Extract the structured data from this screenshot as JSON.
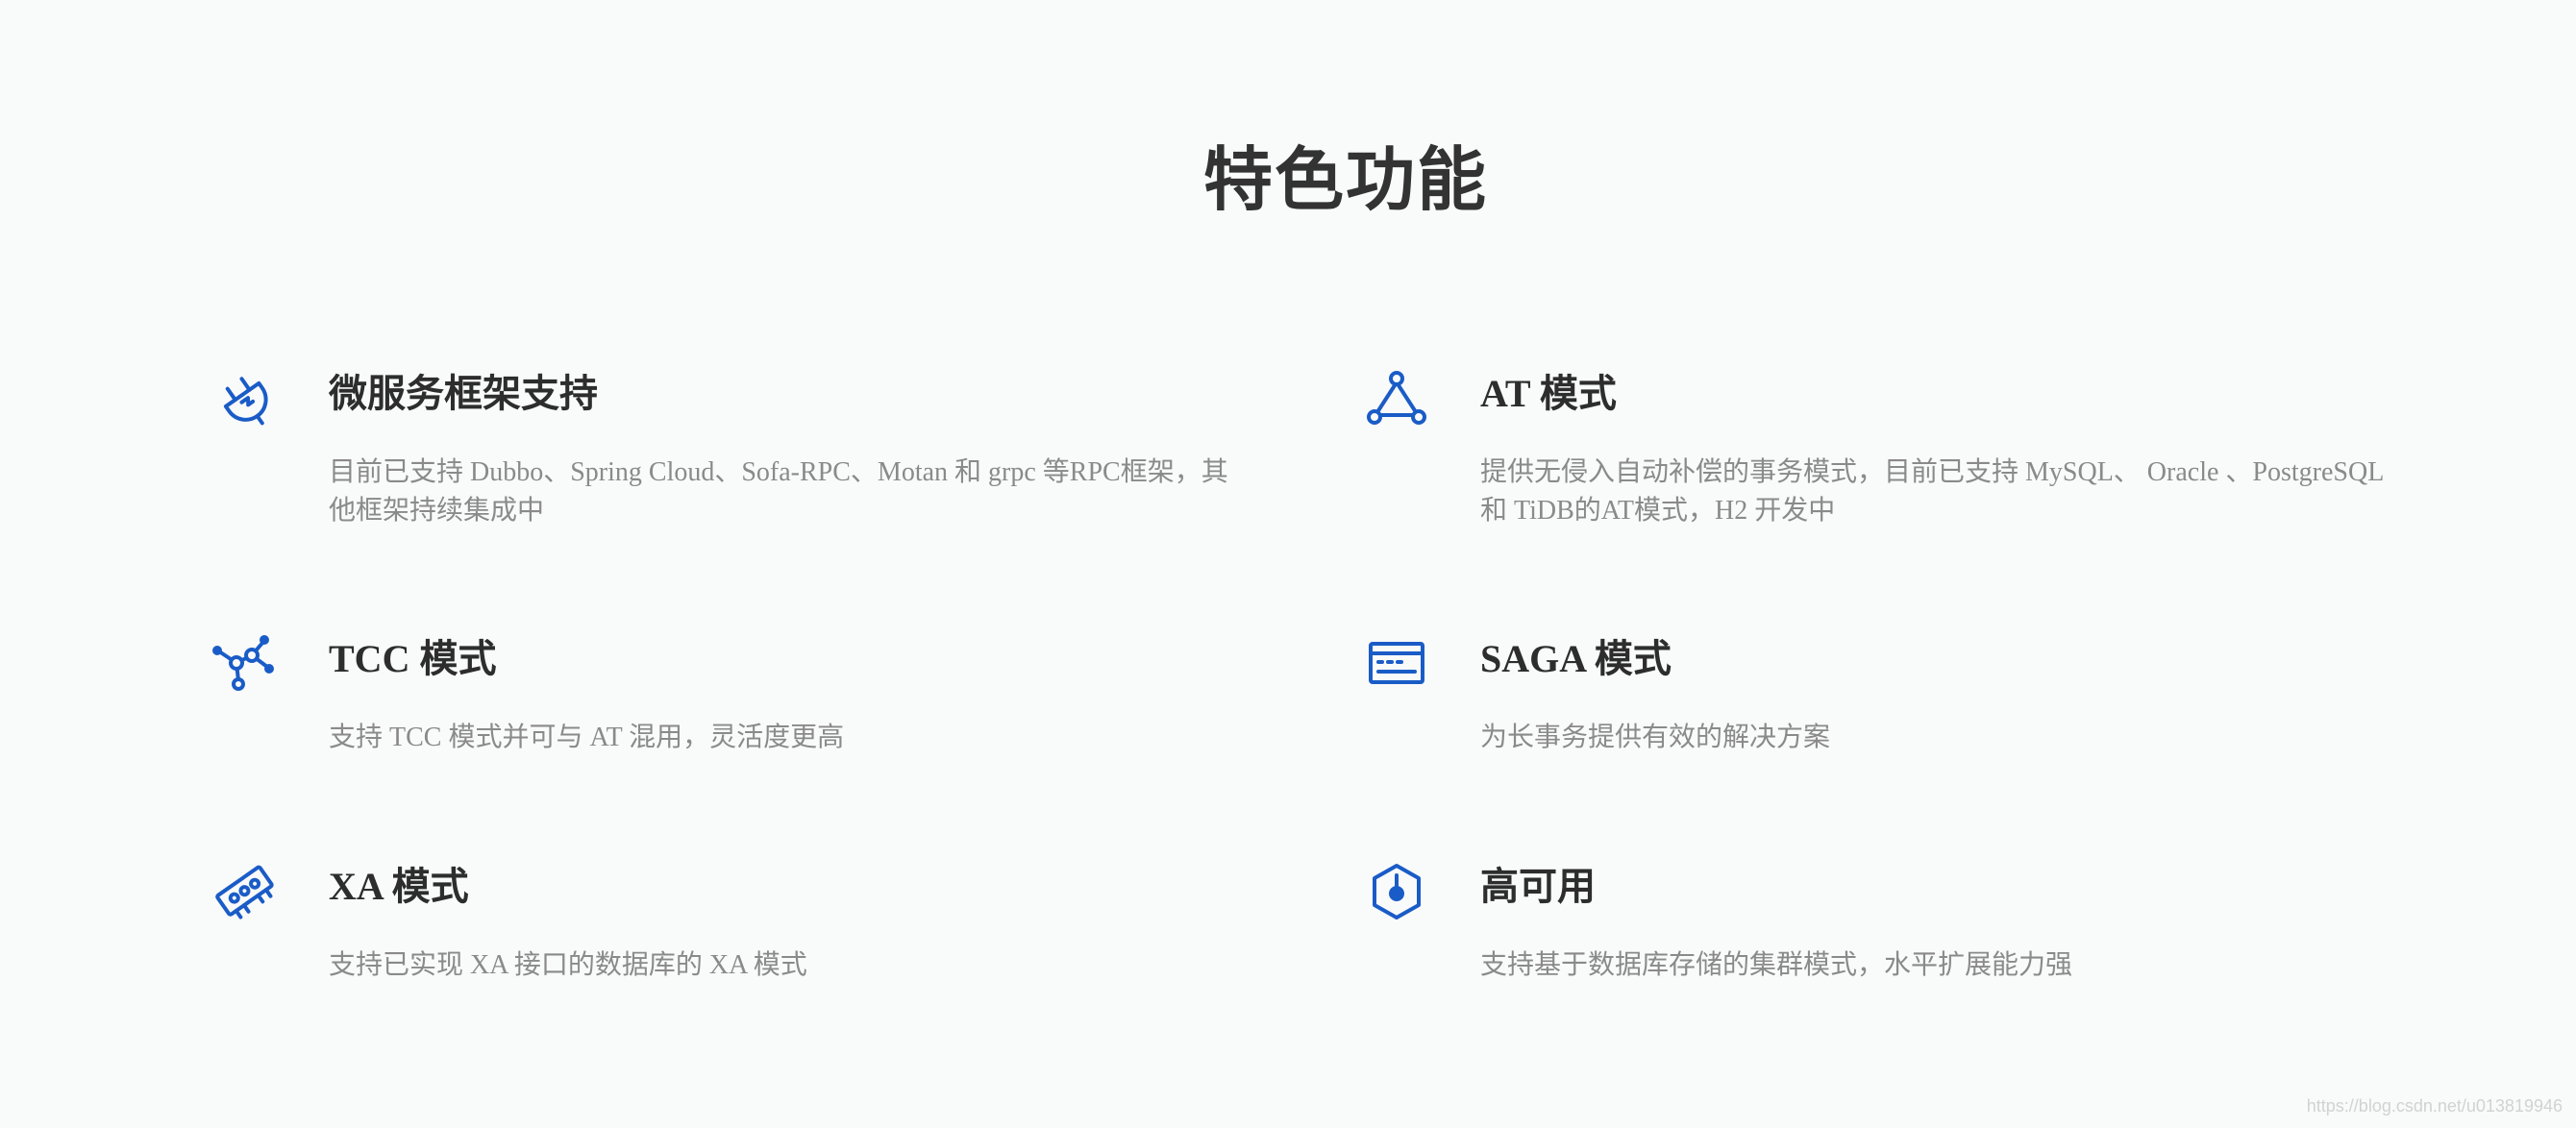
{
  "section": {
    "title": "特色功能"
  },
  "theme": {
    "accent": "#1a5cc7",
    "background": "#f9fafa"
  },
  "features": [
    {
      "icon": "plug-icon",
      "title": "微服务框架支持",
      "description": "目前已支持 Dubbo、Spring Cloud、Sofa-RPC、Motan 和 grpc 等RPC框架，其他框架持续集成中"
    },
    {
      "icon": "triangle-nodes-icon",
      "title": "AT 模式",
      "description": "提供无侵入自动补偿的事务模式，目前已支持 MySQL、 Oracle 、PostgreSQL 和 TiDB的AT模式，H2 开发中"
    },
    {
      "icon": "molecule-nodes-icon",
      "title": "TCC 模式",
      "description": "支持 TCC 模式并可与 AT 混用，灵活度更高"
    },
    {
      "icon": "window-panel-icon",
      "title": "SAGA 模式",
      "description": "为长事务提供有效的解决方案"
    },
    {
      "icon": "chip-icon",
      "title": "XA 模式",
      "description": "支持已实现 XA 接口的数据库的 XA 模式"
    },
    {
      "icon": "hexagon-icon",
      "title": "高可用",
      "description": "支持基于数据库存储的集群模式，水平扩展能力强"
    }
  ],
  "watermark": "https://blog.csdn.net/u013819946"
}
